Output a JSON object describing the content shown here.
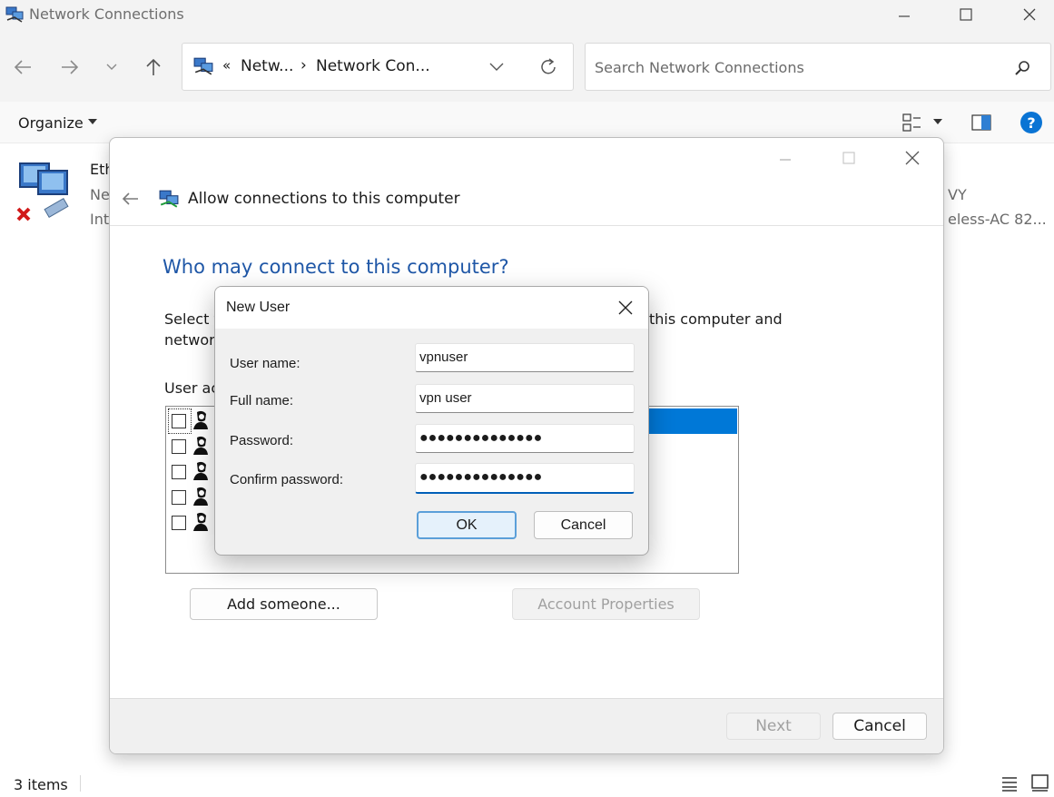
{
  "explorer": {
    "title": "Network Connections",
    "breadcrumb": [
      "«",
      "Netw...",
      "›",
      "Network Con..."
    ],
    "search_placeholder": "Search Network Connections",
    "organize_label": "Organize",
    "status_items": "3 items",
    "adapter": {
      "name_partial": "Eth",
      "line2_partial": "Ne",
      "line3_partial": "Int",
      "right_line2_partial": "VY",
      "right_line3_partial": "eless-AC 82..."
    }
  },
  "wizard": {
    "header_title": "Allow connections to this computer",
    "question": "Who may connect to this computer?",
    "desc_left1": "Select t",
    "desc_left2": "networ",
    "desc_right1": "this computer and",
    "user_accounts_label": "User ac",
    "add_someone_label": "Add someone...",
    "account_properties_label": "Account Properties",
    "next_label": "Next",
    "cancel_label": "Cancel"
  },
  "modal": {
    "title": "New User",
    "fields": [
      {
        "label": "User name:",
        "value": "vpnuser"
      },
      {
        "label": "Full name:",
        "value": "vpn user"
      },
      {
        "label": "Password:",
        "value": "●●●●●●●●●●●●●●"
      },
      {
        "label": "Confirm password:",
        "value": "●●●●●●●●●●●●●●"
      }
    ],
    "ok_label": "OK",
    "cancel_label": "Cancel"
  },
  "colors": {
    "accent": "#005fb8",
    "heading_blue": "#1f57a7",
    "selection_blue": "#0078d7",
    "help_blue": "#0a74d4"
  }
}
